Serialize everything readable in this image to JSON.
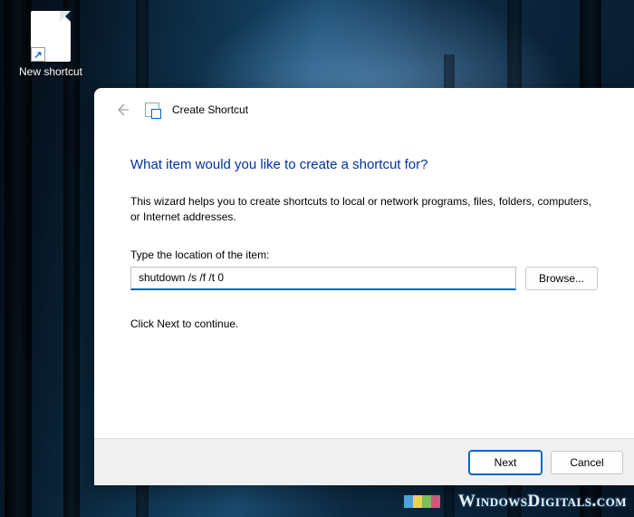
{
  "desktop": {
    "icon_label": "New shortcut"
  },
  "dialog": {
    "title": "Create Shortcut",
    "heading": "What item would you like to create a shortcut for?",
    "description": "This wizard helps you to create shortcuts to local or network programs, files, folders, computers, or Internet addresses.",
    "location_label": "Type the location of the item:",
    "location_value": "shutdown /s /f /t 0",
    "browse_label": "Browse...",
    "continue_hint": "Click Next to continue.",
    "next_label": "Next",
    "cancel_label": "Cancel"
  },
  "watermark": {
    "text": "WindowsDigitals.com"
  }
}
